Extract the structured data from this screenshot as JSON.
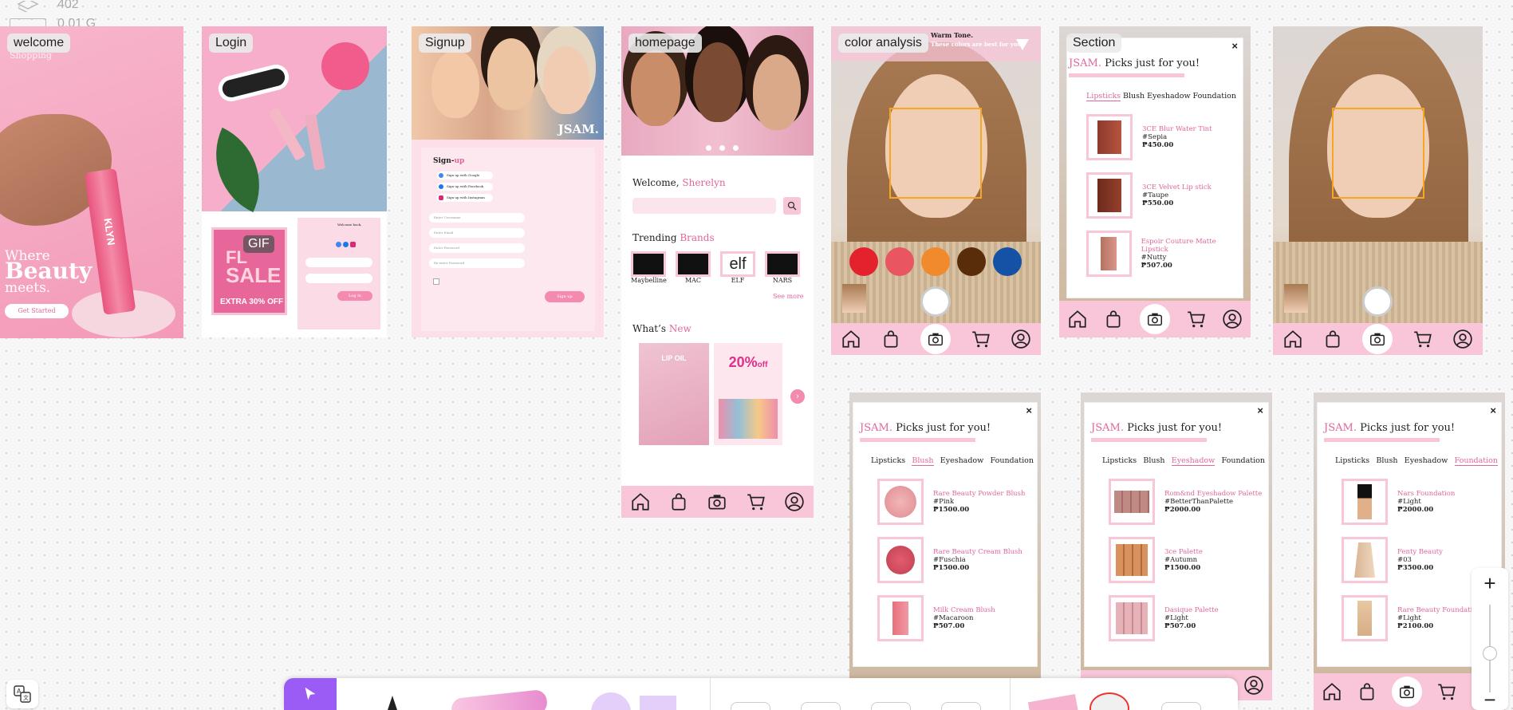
{
  "canvas_info": {
    "layers": "402",
    "size": "0.01 G"
  },
  "frames": {
    "welcome": {
      "label": "welcome",
      "shopping": "Shopping",
      "line1": "Where",
      "line2": "Beauty",
      "line3": "meets.",
      "cta": "Get Started",
      "brand_on_product": "KLYN"
    },
    "login": {
      "label": "Login",
      "gif": "GIF",
      "sale_line1": "FL",
      "sale_line2": "SALE",
      "sale_extra": "EXTRA 30% OFF",
      "welcome_back": "Welcome back,",
      "login_btn": "Log in"
    },
    "signup": {
      "label": "Signup",
      "brand": "JSAM.",
      "title_a": "Sign-",
      "title_b": "up",
      "google": "Sign up with Google",
      "facebook": "Sign up with Facebook",
      "instagram": "Sign up with Instagram",
      "fields": [
        "Enter Username",
        "Enter Email",
        "Enter Password",
        "Re-enter Password"
      ],
      "button": "Sign up"
    },
    "homepage": {
      "label": "homepage",
      "welcome": "Welcome,",
      "username": "Sherelyn",
      "trending_a": "Trending",
      "trending_b": "Brands",
      "brands": [
        "Maybelline",
        "MAC",
        "ELF",
        "NARS"
      ],
      "see_more": "See more",
      "whats": "What’s",
      "new": "New",
      "promo1": "LIP OIL",
      "promo2a": "20%",
      "promo2b": "off"
    },
    "color_analysis": {
      "label": "color analysis",
      "banner_a": "Warm Tone.",
      "banner_b": "These colors are best for you!",
      "swatches": [
        "#e4222e",
        "#ea5562",
        "#f08a2c",
        "#5a2d0a",
        "#1552a5"
      ]
    },
    "section": {
      "label": "Section"
    }
  },
  "picks": {
    "brand": "JSAM.",
    "title": "Picks just for you!",
    "tabs": [
      "Lipsticks",
      "Blush",
      "Eyeshadow",
      "Foundation"
    ],
    "lipsticks": [
      {
        "name": "3CE Blur Water Tint",
        "shade": "#Sepia",
        "price": "₱450.00"
      },
      {
        "name": "3CE Velvet Lip stick",
        "shade": "#Taupe",
        "price": "₱550.00"
      },
      {
        "name": "Espoir Couture Matte Lipstick",
        "shade": "#Nutty",
        "price": "₱507.00"
      }
    ],
    "blush": [
      {
        "name": "Rare Beauty Powder Blush",
        "shade": "#Pink",
        "price": "₱1500.00"
      },
      {
        "name": "Rare Beauty Cream Blush",
        "shade": "#Fuschia",
        "price": "₱1500.00"
      },
      {
        "name": "Milk Cream Blush",
        "shade": "#Macaroon",
        "price": "₱507.00"
      }
    ],
    "eyeshadow": [
      {
        "name": "Rom&nd Eyeshadow Palette",
        "shade": "#BetterThanPalette",
        "price": "₱2000.00"
      },
      {
        "name": "3ce Palette",
        "shade": "#Autumn",
        "price": "₱1500.00"
      },
      {
        "name": "Dasique Palette",
        "shade": "#Light",
        "price": "₱507.00"
      }
    ],
    "foundation": [
      {
        "name": "Nars Foundation",
        "shade": "#Light",
        "price": "₱2000.00"
      },
      {
        "name": "Fenty Beauty",
        "shade": "#03",
        "price": "₱3500.00"
      },
      {
        "name": "Rare Beauty Foundation",
        "shade": "#Light",
        "price": "₱2100.00"
      }
    ]
  },
  "nav_icons": [
    "home-icon",
    "bag-icon",
    "camera-icon",
    "cart-icon",
    "profile-icon"
  ],
  "zoom_controls": {
    "plus": "+",
    "minus": "−"
  },
  "colors": {
    "accent": "#e0679c",
    "nav_bg": "#f8c6d8",
    "toolbar_accent": "#9b5cf6"
  }
}
